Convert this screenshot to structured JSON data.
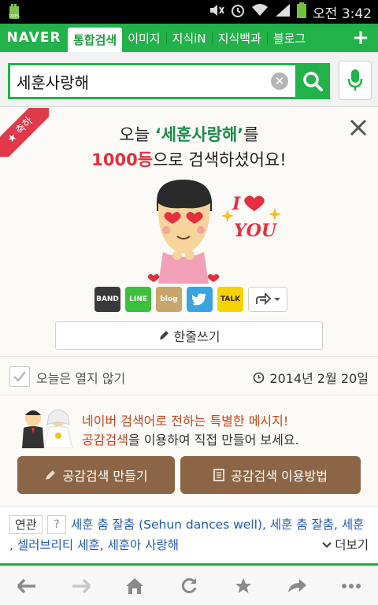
{
  "status_bar": {
    "time": "오전 3:42",
    "icons": [
      "sd-card-icon",
      "mute-icon",
      "alarm-icon",
      "wifi-icon",
      "signal-icon",
      "battery-icon"
    ]
  },
  "nav": {
    "logo": "NAVER",
    "tabs": [
      {
        "label": "통합검색",
        "active": true
      },
      {
        "label": "이미지"
      },
      {
        "label": "지식iN"
      },
      {
        "label": "지식백과"
      },
      {
        "label": "블로그"
      }
    ],
    "plus_icon": "plus-icon",
    "brand_color": "#23b14a"
  },
  "search": {
    "query": "세훈사랑해"
  },
  "celebrate": {
    "ribbon": "축하",
    "headline_prefix": "오늘 ",
    "headline_query": "‘세훈사랑해’",
    "headline_after_query": "를",
    "headline_rank": "1000등",
    "headline_suffix": "으로 검색하셨어요!",
    "character_text": "I ♥ YOU",
    "share_icons": [
      {
        "name": "band",
        "label": "BAND",
        "color": "#3a3a3a"
      },
      {
        "name": "line",
        "label": "LINE",
        "color": "#3bc13b"
      },
      {
        "name": "blog",
        "label": "blog",
        "color": "#c8a56a"
      },
      {
        "name": "twitter",
        "label": "",
        "color": "#38a4e0"
      },
      {
        "name": "kakaotalk",
        "label": "TALK",
        "color": "#f5d300"
      }
    ],
    "write_label": "한줄쓰기"
  },
  "dismiss": {
    "label": "오늘은 열지 않기",
    "date": "2014년 2월 20일"
  },
  "empathy": {
    "line1": "네이버 검색어로 전하는 특별한 메시지!",
    "line2_keyword": "공감검색",
    "line2_rest": "을 이용하여 직접 만들어 보세요.",
    "make_button": "공감검색 만들기",
    "howto_button": "공감검색 이용방법"
  },
  "related": {
    "tag": "연관",
    "help": "?",
    "line1_items": [
      "세훈 춤 잘춤 (Sehun dances well)",
      "세훈 춤 잘춤",
      "세훈"
    ],
    "line2_items": [
      "셀러브리티 세훈",
      "세훈아 사랑해"
    ],
    "separator": ",",
    "more": "더보기"
  },
  "bottom_bar": {
    "buttons": [
      "back-icon",
      "forward-icon",
      "home-icon",
      "reload-icon",
      "bookmark-star-icon",
      "share-icon",
      "more-icon"
    ]
  }
}
